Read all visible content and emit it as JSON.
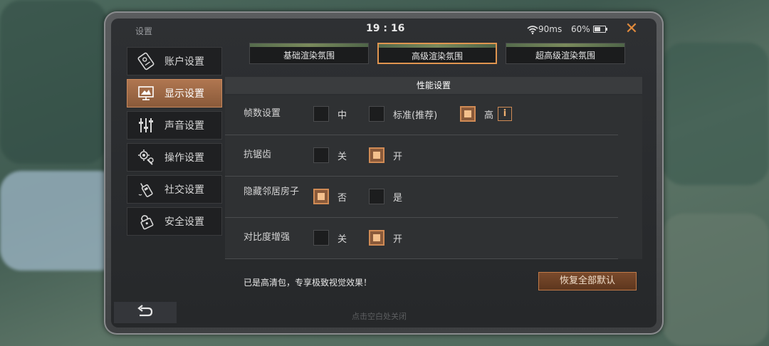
{
  "window": {
    "title": "设置",
    "time": "19 : 16",
    "ping": "90ms",
    "battery": "60%",
    "battery_level": 0.6
  },
  "icons": {
    "close": "close-icon",
    "wifi": "wifi-icon",
    "battery": "battery-icon",
    "back": "back-arrow-icon"
  },
  "sidebar": {
    "items": [
      {
        "label": "账户设置",
        "icon": "account-card-icon",
        "active": false
      },
      {
        "label": "显示设置",
        "icon": "display-monitor-icon",
        "active": true
      },
      {
        "label": "声音设置",
        "icon": "sound-sliders-icon",
        "active": false
      },
      {
        "label": "操作设置",
        "icon": "controls-gear-icon",
        "active": false
      },
      {
        "label": "社交设置",
        "icon": "walkie-talkie-icon",
        "active": false
      },
      {
        "label": "安全设置",
        "icon": "security-lock-icon",
        "active": false
      }
    ]
  },
  "render_tabs": [
    {
      "label": "基础渲染氛围",
      "selected": false
    },
    {
      "label": "高级渲染氛围",
      "selected": true
    },
    {
      "label": "超高级渲染氛围",
      "selected": false
    }
  ],
  "section": {
    "title": "性能设置"
  },
  "settings": [
    {
      "label": "帧数设置",
      "options": [
        {
          "label": "中",
          "checked": false
        },
        {
          "label": "标准(推荐)",
          "checked": false
        },
        {
          "label": "高",
          "checked": true,
          "info": "i"
        }
      ]
    },
    {
      "label": "抗锯齿",
      "options": [
        {
          "label": "关",
          "checked": false
        },
        {
          "label": "开",
          "checked": true
        }
      ]
    },
    {
      "label": "隐藏邻居房子",
      "options": [
        {
          "label": "否",
          "checked": true
        },
        {
          "label": "是",
          "checked": false
        }
      ]
    },
    {
      "label": "对比度增强",
      "options": [
        {
          "label": "关",
          "checked": false
        },
        {
          "label": "开",
          "checked": true
        }
      ]
    }
  ],
  "footer": {
    "note": "已是高清包，专享极致视觉效果！",
    "reset_label": "恢复全部默认",
    "tap_hint": "点击空白处关闭"
  },
  "colors": {
    "accent": "#d08b55",
    "active_tab": "#e0954f",
    "background": "#2e3033"
  }
}
